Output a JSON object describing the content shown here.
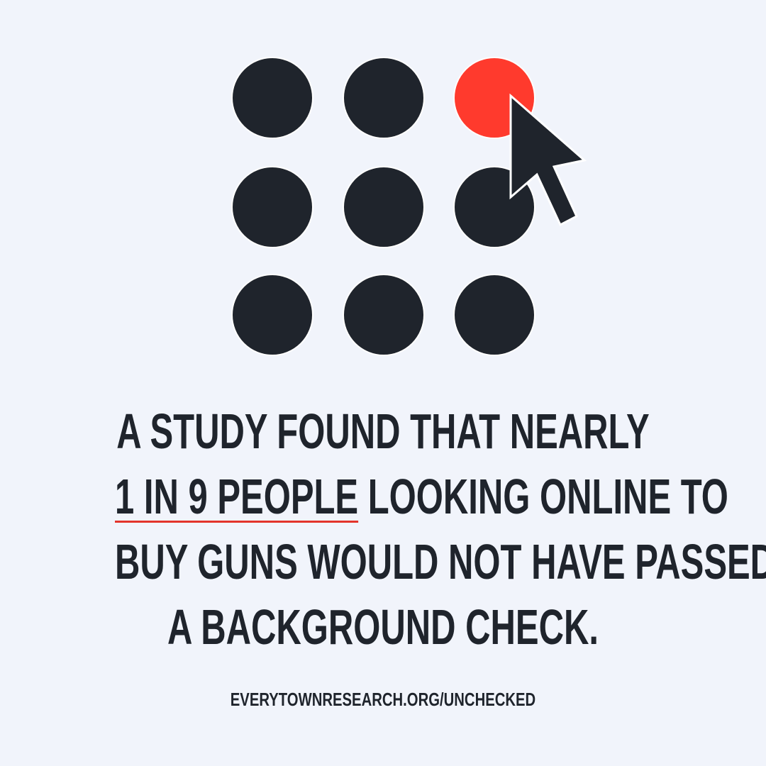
{
  "graphic": {
    "dot_count": 9,
    "highlighted_dot": 3,
    "dot_color": "#1f242c",
    "highlight_color": "#ff3a2d",
    "cursor_icon": "mouse-pointer-icon"
  },
  "headline": {
    "line1": "A STUDY FOUND THAT NEARLY",
    "line2_emphasis": "1 IN 9 PEOPLE",
    "line2_rest": " LOOKING ONLINE TO",
    "line3": "BUY GUNS WOULD NOT HAVE PASSED",
    "line4": "A BACKGROUND CHECK."
  },
  "source_url": "EVERYTOWNRESEARCH.ORG/UNCHECKED",
  "colors": {
    "background": "#f1f4fb",
    "text": "#1f242c",
    "underline": "#e3342b"
  }
}
